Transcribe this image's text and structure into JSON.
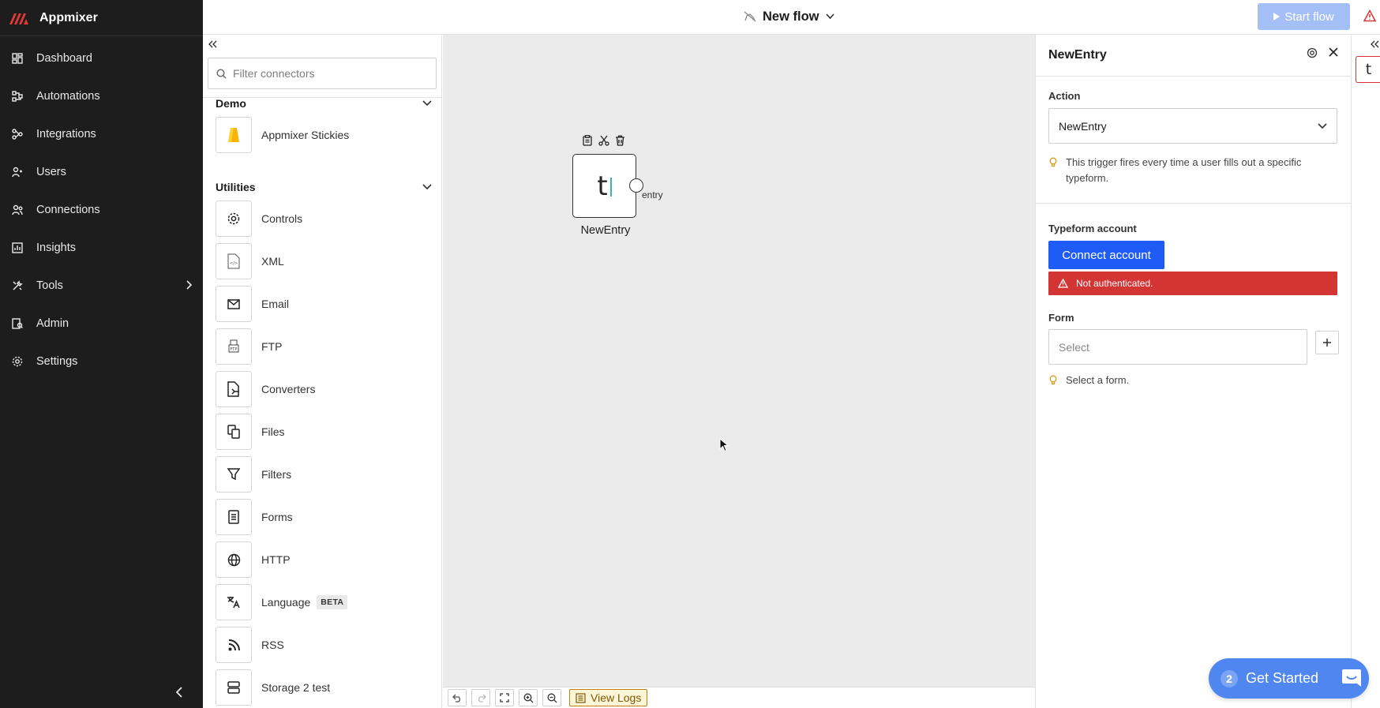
{
  "app": {
    "name": "Appmixer",
    "brand_color": "#e53935"
  },
  "sidebar": {
    "items": [
      {
        "label": "Dashboard",
        "icon": "dashboard-icon"
      },
      {
        "label": "Automations",
        "icon": "automations-icon"
      },
      {
        "label": "Integrations",
        "icon": "integrations-icon"
      },
      {
        "label": "Users",
        "icon": "users-icon"
      },
      {
        "label": "Connections",
        "icon": "connections-icon"
      },
      {
        "label": "Insights",
        "icon": "insights-icon"
      },
      {
        "label": "Tools",
        "icon": "tools-icon"
      },
      {
        "label": "Admin",
        "icon": "admin-icon"
      },
      {
        "label": "Settings",
        "icon": "settings-icon"
      }
    ]
  },
  "header": {
    "flow_title": "New flow",
    "start_label": "Start flow"
  },
  "connectors": {
    "filter_placeholder": "Filter connectors",
    "groups": [
      {
        "name": "Demo",
        "items": [
          {
            "label": "Appmixer Stickies"
          }
        ]
      },
      {
        "name": "Utilities",
        "items": [
          {
            "label": "Controls"
          },
          {
            "label": "XML"
          },
          {
            "label": "Email"
          },
          {
            "label": "FTP"
          },
          {
            "label": "Converters"
          },
          {
            "label": "Files"
          },
          {
            "label": "Filters"
          },
          {
            "label": "Forms"
          },
          {
            "label": "HTTP"
          },
          {
            "label": "Language",
            "badge": "BETA"
          },
          {
            "label": "RSS"
          },
          {
            "label": "Storage 2 test"
          }
        ]
      }
    ]
  },
  "canvas": {
    "node": {
      "glyph": "t",
      "label": "NewEntry",
      "port_label": "entry"
    },
    "toolbar": {
      "view_logs": "View Logs"
    }
  },
  "inspector": {
    "title": "NewEntry",
    "action_label": "Action",
    "action_value": "NewEntry",
    "action_hint": "This trigger fires every time a user fills out a specific typeform.",
    "account_label": "Typeform account",
    "connect_label": "Connect account",
    "error_text": "Not authenticated.",
    "form_label": "Form",
    "form_placeholder": "Select",
    "form_hint": "Select a form."
  },
  "right_strip": {
    "glyph": "t"
  },
  "get_started": {
    "count": "2",
    "label": "Get Started"
  },
  "colors": {
    "accent": "#1e5cf5",
    "error": "#d33534",
    "sidebar_bg": "#1d1d1d",
    "canvas_bg": "#ebebeb",
    "start_disabled": "#a3bff5",
    "widget": "#4f86f0"
  }
}
